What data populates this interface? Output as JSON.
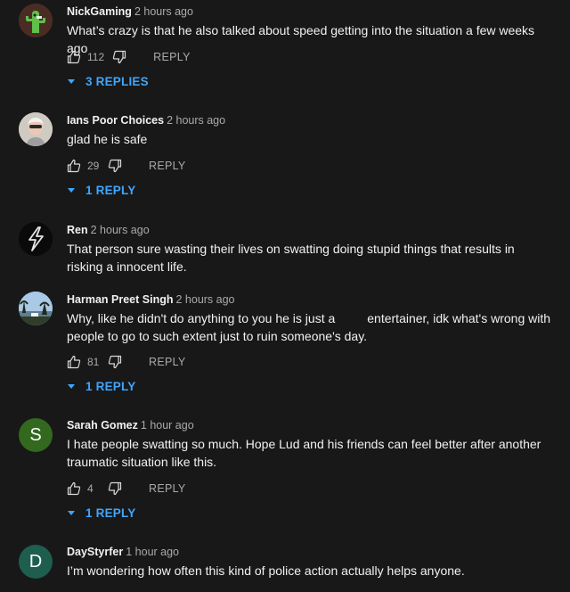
{
  "comments": [
    {
      "author": "NickGaming",
      "time": "2 hours ago",
      "text": "What’s crazy is that he also talked about speed getting into the situation a few weeks ago",
      "likes": "112",
      "reply_label": "REPLY",
      "replies_label": "3 REPLIES",
      "avatar_icon": "green-cactus-avatar"
    },
    {
      "author": "Ians Poor Choices",
      "time": "2 hours ago",
      "text": "glad he is safe",
      "likes": "29",
      "reply_label": "REPLY",
      "replies_label": "1 REPLY",
      "avatar_icon": "person-photo-avatar"
    },
    {
      "author": "Ren",
      "time": "2 hours ago",
      "text": "That person sure wasting their lives on swatting doing stupid things that results in risking a innocent life.",
      "avatar_icon": "lightning-bolt-avatar"
    },
    {
      "author": "Harman Preet Singh",
      "time": "2 hours ago",
      "text_line1": "Why, like he didn't do anything to you he is just a",
      "text_line1b": "entertainer, idk what's wrong with",
      "text_line2": "people to go to such extent just to ruin someone's day.",
      "likes": "81",
      "reply_label": "REPLY",
      "replies_label": "1 REPLY",
      "avatar_icon": "landscape-photo-avatar"
    },
    {
      "author": "Sarah Gomez",
      "time": "1 hour ago",
      "text": "I hate people swatting so much. Hope Lud and his friends can feel better after another traumatic situation like this.",
      "likes": "4",
      "reply_label": "REPLY",
      "replies_label": "1 REPLY",
      "avatar_letter": "S",
      "avatar_color": "#33691e"
    },
    {
      "author": "DayStyrfer",
      "time": "1 hour ago",
      "text": "I’m wondering how often this kind of police action actually helps anyone.",
      "avatar_letter": "D",
      "avatar_color": "#1e5e4e"
    }
  ],
  "colors": {
    "background": "#181818",
    "text": "#f1f1f1",
    "muted": "#aaaaaa",
    "link": "#3ea6ff"
  }
}
